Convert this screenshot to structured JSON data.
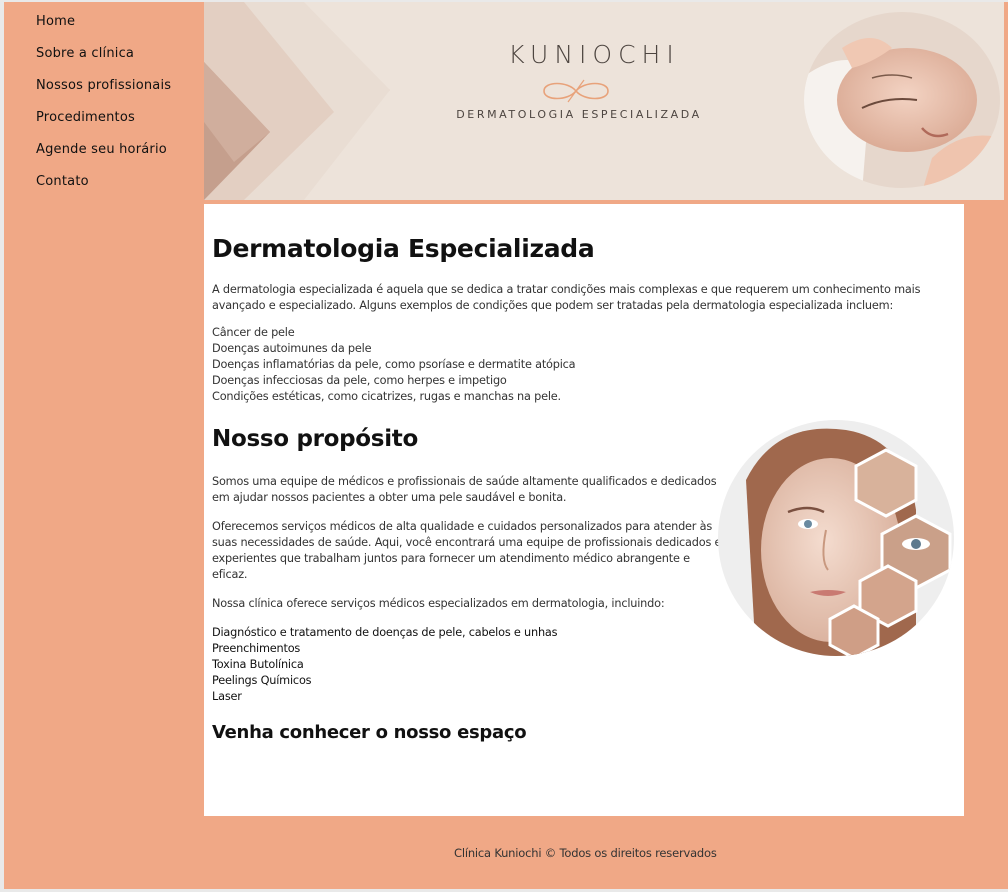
{
  "nav": {
    "items": [
      "Home",
      "Sobre a clínica",
      "Nossos profissionais",
      "Procedimentos",
      "Agende seu horário",
      "Contato"
    ]
  },
  "banner": {
    "logo_title": "KUNIOCHI",
    "logo_subtitle": "DERMATOLOGIA ESPECIALIZADA"
  },
  "content": {
    "title": "Dermatologia  Especializada",
    "intro": "A dermatologia especializada é aquela que se dedica a tratar condições mais complexas e que requerem um conhecimento mais avançado e especializado. Alguns exemplos de condições que podem ser tratadas pela dermatologia especializada incluem:",
    "conditions": [
      "Câncer de pele",
      "Doenças autoimunes da pele",
      "Doenças inflamatórias da pele, como psoríase e dermatite atópica",
      "Doenças infecciosas da pele, como herpes e impetigo",
      "Condições estéticas, como cicatrizes, rugas e manchas na pele."
    ],
    "purpose_title": "Nosso propósito",
    "purpose_p1": "Somos uma equipe de médicos e profissionais de saúde altamente qualificados e dedicados em ajudar nossos pacientes a obter uma pele saudável e bonita.",
    "purpose_p2": "Oferecemos serviços médicos de alta qualidade e cuidados personalizados para atender às suas necessidades de saúde. Aqui, você encontrará uma equipe de profissionais dedicados e experientes que trabalham juntos para fornecer um atendimento médico abrangente e eficaz.",
    "purpose_p3": "Nossa clínica oferece serviços médicos especializados em dermatologia, incluindo:",
    "services": [
      "Diagnóstico e tratamento de doenças de pele, cabelos e unhas",
      "Preenchimentos",
      "Toxina  Butolínica",
      "Peelings Químicos",
      "Laser"
    ],
    "visit_title": "Venha conhecer o nosso espaço"
  },
  "footer": {
    "text": "Clínica  Kuniochi © Todos os direitos reservados"
  },
  "colors": {
    "background": "#f0a886",
    "banner": "#ede3da",
    "accent": "#e8a27a"
  }
}
